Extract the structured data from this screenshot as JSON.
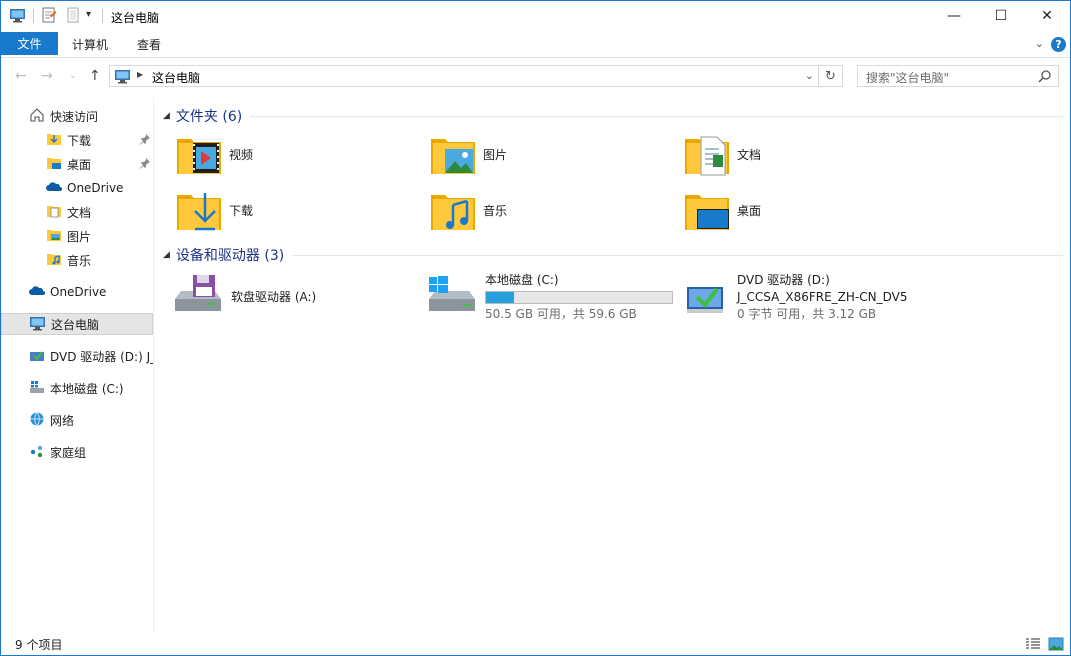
{
  "window": {
    "title": "这台电脑",
    "minimize_glyph": "—",
    "maximize_glyph": "☐",
    "close_glyph": "✕"
  },
  "ribbon": {
    "file_tab": "文件",
    "tabs": [
      "计算机",
      "查看"
    ],
    "help_glyph": "?"
  },
  "address": {
    "path": "这台电脑",
    "search_placeholder": "搜索\"这台电脑\""
  },
  "nav": {
    "quick_access": "快速访问",
    "quick_items": [
      {
        "label": "下载",
        "icon": "download-folder-icon",
        "pinned": true
      },
      {
        "label": "桌面",
        "icon": "desktop-folder-icon",
        "pinned": true
      },
      {
        "label": "OneDrive",
        "icon": "onedrive-icon",
        "pinned": false
      },
      {
        "label": "文档",
        "icon": "documents-folder-icon",
        "pinned": false
      },
      {
        "label": "图片",
        "icon": "pictures-folder-icon",
        "pinned": false
      },
      {
        "label": "音乐",
        "icon": "music-folder-icon",
        "pinned": false
      }
    ],
    "onedrive": "OneDrive",
    "this_pc": "这台电脑",
    "dvd": "DVD 驱动器 (D:) J_",
    "local_disk": "本地磁盘 (C:)",
    "network": "网络",
    "homegroup": "家庭组"
  },
  "folders_group": {
    "title": "文件夹 (6)",
    "items": [
      {
        "label": "视频",
        "icon": "videos-folder-icon"
      },
      {
        "label": "图片",
        "icon": "pictures-folder-icon"
      },
      {
        "label": "文档",
        "icon": "documents-folder-icon"
      },
      {
        "label": "下载",
        "icon": "downloads-folder-icon"
      },
      {
        "label": "音乐",
        "icon": "music-folder-icon"
      },
      {
        "label": "桌面",
        "icon": "desktop-folder-icon"
      }
    ]
  },
  "devices_group": {
    "title": "设备和驱动器 (3)",
    "floppy": {
      "label": "软盘驱动器 (A:)",
      "icon": "floppy-drive-icon"
    },
    "local": {
      "label": "本地磁盘 (C:)",
      "usage": "50.5 GB 可用，共 59.6 GB",
      "used_fraction": 0.153,
      "icon": "local-disk-icon"
    },
    "dvd": {
      "label": "DVD 驱动器 (D:)",
      "volume": "J_CCSA_X86FRE_ZH-CN_DV5",
      "usage": "0 字节 可用，共 3.12 GB",
      "icon": "dvd-drive-icon"
    }
  },
  "status": {
    "item_count": "9 个项目"
  },
  "colors": {
    "accent": "#1979ca",
    "group_title": "#1e3287",
    "folder": "#ffc83d",
    "bar_fill": "#26a0da"
  }
}
